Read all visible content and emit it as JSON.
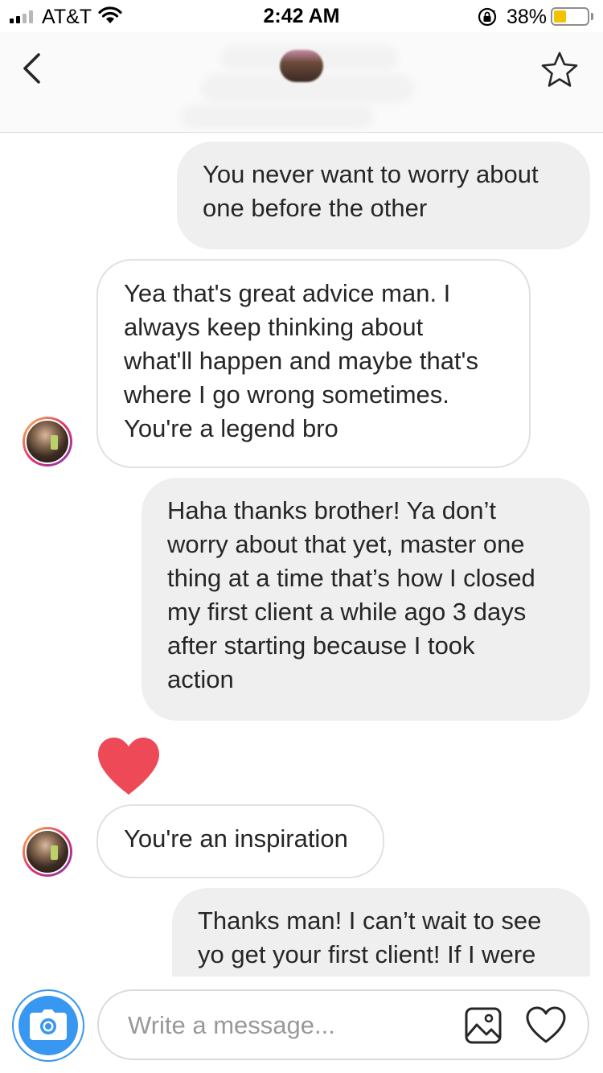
{
  "status_bar": {
    "carrier": "AT&T",
    "time": "2:42 AM",
    "battery_percent": "38%",
    "battery_level": 0.38,
    "battery_color": "#f2c300",
    "signal_bars_active": 2,
    "icons": [
      "signal-icon",
      "wifi-icon",
      "rotation-lock-icon",
      "battery-icon"
    ]
  },
  "header": {
    "contact_name": "",
    "icons": [
      "back-chevron-icon",
      "star-icon"
    ]
  },
  "messages": [
    {
      "sender": "me",
      "text_lines": [
        "You never want to worry about",
        "one before the other"
      ]
    },
    {
      "sender": "them",
      "text_lines": [
        "Yea that's great advice man. I",
        "always keep thinking about",
        "what'll happen and maybe that's",
        "where I go wrong sometimes.",
        "You're a legend bro"
      ]
    },
    {
      "sender": "me",
      "text_lines": [
        "Haha thanks brother! Ya don’t",
        "worry about that yet, master one",
        "thing at a time that’s how I closed",
        "my first client a while ago 3 days",
        "after starting because I took",
        "action"
      ]
    },
    {
      "sender": "them",
      "reaction": "heart",
      "reaction_color": "#ed4956"
    },
    {
      "sender": "them",
      "text_lines": [
        "You're an inspiration"
      ]
    },
    {
      "sender": "me",
      "text_lines": [
        "Thanks man! I can’t wait to see",
        "yo get your first client! If I were"
      ]
    }
  ],
  "composer": {
    "placeholder": "Write a message...",
    "value": "",
    "icons": [
      "camera-icon",
      "gallery-icon",
      "heart-icon"
    ]
  },
  "colors": {
    "accent_blue": "#3897f0",
    "sent_bubble": "#efefef",
    "received_border": "#e1e1e1",
    "heart_red": "#ed4956"
  }
}
